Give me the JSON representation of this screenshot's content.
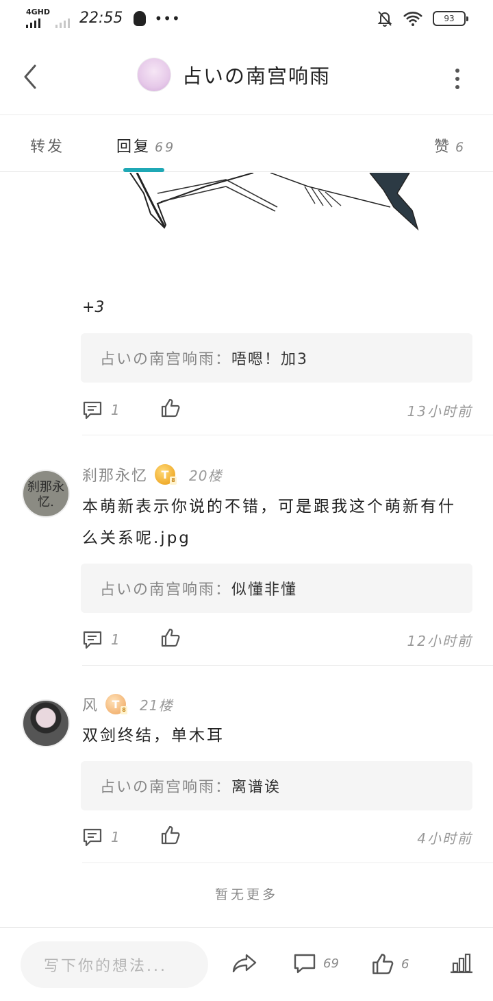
{
  "status_bar": {
    "network": "4GHD",
    "time": "22:55",
    "more_dots": "•••",
    "battery": "93"
  },
  "header": {
    "title": "占いの南宫响雨"
  },
  "tabs": {
    "repost": "转发",
    "reply": "回复",
    "reply_count": "69",
    "like": "赞",
    "like_count": "6"
  },
  "comments": [
    {
      "text": "+3",
      "reply_author": "占いの南宫响雨：",
      "reply_text": "唔嗯！加3",
      "reply_count": "1",
      "time": "13小时前"
    },
    {
      "avatar_text": "刹那永忆.",
      "name": "刹那永忆",
      "level_badge": "T",
      "floor": "20楼",
      "text": "本萌新表示你说的不错，可是跟我这个萌新有什么关系呢.jpg",
      "reply_author": "占いの南宫响雨：",
      "reply_text": "似懂非懂",
      "reply_count": "1",
      "time": "12小时前"
    },
    {
      "name": "风",
      "level_badge": "T",
      "floor": "21楼",
      "text": "双剑终结，单木耳",
      "reply_author": "占いの南宫响雨：",
      "reply_text": "离谱诶",
      "reply_count": "1",
      "time": "4小时前"
    }
  ],
  "footer_note": "暂无更多",
  "bottom_bar": {
    "input_placeholder": "写下你的想法...",
    "comment_count": "69",
    "like_count": "6"
  }
}
